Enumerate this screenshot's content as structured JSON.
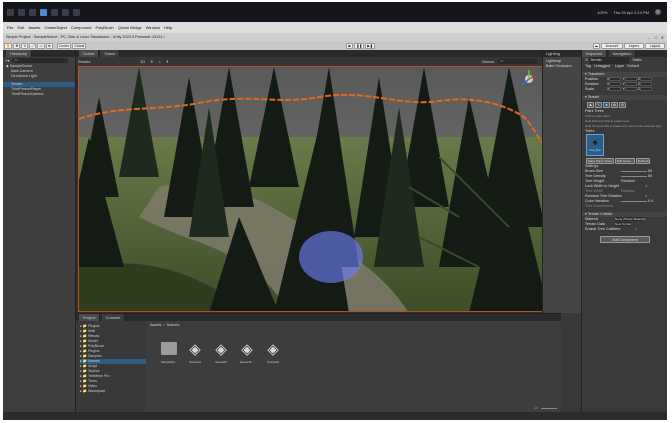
{
  "os": {
    "tray_text": "Thu 20 Apr 2:14 PM",
    "battery": "100%",
    "user_initial": "E"
  },
  "window": {
    "title": "Simple Project - SampleScene - PC, Mac & Linux Standalone - Unity 2020.3 Personal <DX11>"
  },
  "menu": [
    "File",
    "Edit",
    "Assets",
    "GameObject",
    "Component",
    "PolyBrush",
    "Quixel Bridge",
    "Window",
    "Help"
  ],
  "toolbar": {
    "pivot_label": "Center",
    "space_label": "Global",
    "play_label": "▶",
    "pause_label": "❚❚",
    "step_label": "▶❚",
    "account_label": "Account",
    "layers_label": "Layers",
    "layout_label": "Layout"
  },
  "hierarchy": {
    "tab_label": "Hierarchy",
    "search_placeholder": "All",
    "items": [
      {
        "label": "SampleScene",
        "depth": 0,
        "selected": false
      },
      {
        "label": "Main Camera",
        "depth": 1,
        "selected": false
      },
      {
        "label": "Directional Light",
        "depth": 1,
        "selected": false
      },
      {
        "label": "Terrain",
        "depth": 1,
        "selected": true
      },
      {
        "label": "ThirdPersonPlayer",
        "depth": 1,
        "selected": false
      },
      {
        "label": "ThirdPersonCamera",
        "depth": 1,
        "selected": false
      }
    ]
  },
  "scene": {
    "tabs": [
      "Scene",
      "Game"
    ],
    "active_tab": "Scene",
    "shading_mode": "Shaded",
    "mode_2d": "2D",
    "gizmos_label": "Gizmos",
    "search_placeholder": "All"
  },
  "lighting": {
    "tab_label": "Lighting",
    "items": [
      "Lightmap",
      "Bake Occlusion"
    ]
  },
  "project": {
    "tabs": [
      "Project",
      "Console"
    ],
    "breadcrumb": [
      "Assets",
      "Scenes"
    ],
    "search_placeholder": "",
    "tree": [
      "Plugins",
      "Matt",
      "Reload",
      "Model",
      "PolyBrush",
      "Plugins",
      "Samples",
      "Scenes",
      "Script",
      "Skybox",
      "TextMesh Pro",
      "Trees",
      "Video",
      "Workspace"
    ],
    "selected_tree_item": "Scenes",
    "files": [
      {
        "name": "SampleSc...",
        "kind": "folder"
      },
      {
        "name": "Scene01",
        "kind": "unity"
      },
      {
        "name": "Scene02",
        "kind": "unity"
      },
      {
        "name": "SceneTe...",
        "kind": "unity"
      },
      {
        "name": "Scene04",
        "kind": "unity"
      }
    ],
    "item_count": "20"
  },
  "inspector": {
    "tabs": [
      "Inspector",
      "Navigation"
    ],
    "object_name": "Terrain",
    "static_label": "Static",
    "tag_label": "Tag",
    "tag_value": "Untagged",
    "layer_label": "Layer",
    "layer_value": "Default",
    "transform": {
      "title": "Transform",
      "rows": [
        {
          "label": "Position",
          "x": "0",
          "y": "0",
          "z": "0"
        },
        {
          "label": "Rotation",
          "x": "0",
          "y": "0",
          "z": "0"
        },
        {
          "label": "Scale",
          "x": "1",
          "y": "1",
          "z": "1"
        }
      ]
    },
    "terrain": {
      "title": "Terrain",
      "paint_trees_label": "Paint Trees",
      "hint_lines": [
        "Click to paint trees.",
        "Hold shift and click to erase trees.",
        "Hold Ctrl and click to erase only trees of the selected type."
      ],
      "trees_label": "Trees",
      "tree_thumb_label": "Tree_Pine",
      "buttons": [
        "Mass Place Trees",
        "Edit Trees...",
        "Refresh"
      ],
      "settings_label": "Settings",
      "fields": [
        {
          "label": "Brush Size",
          "value": "55"
        },
        {
          "label": "Tree Density",
          "value": "80"
        },
        {
          "label": "Tree Height",
          "value": "Random"
        },
        {
          "label": "Lock Width to Height",
          "value": "✓"
        },
        {
          "label": "Tree Width",
          "value": "Random"
        },
        {
          "label": "Random Tree Rotation",
          "value": "✓"
        },
        {
          "label": "Color Variation",
          "value": "0.4"
        },
        {
          "label": "Tree Contribution",
          "value": ""
        }
      ]
    },
    "collider": {
      "title": "Terrain Collider",
      "fields": [
        {
          "label": "Material",
          "value": "None (Physic Material)"
        },
        {
          "label": "Terrain Data",
          "value": "New Terrain"
        },
        {
          "label": "Enable Tree Colliders",
          "value": "✓"
        }
      ]
    },
    "add_component_label": "Add Component"
  }
}
